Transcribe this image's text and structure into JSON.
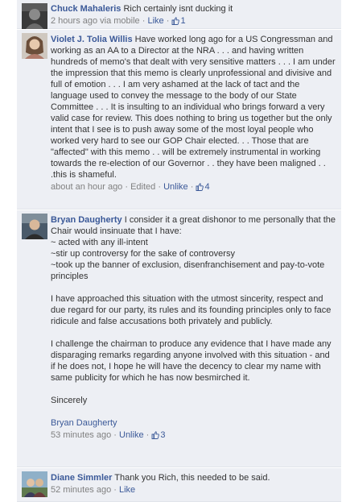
{
  "comments": [
    {
      "author": "Chuck Mahaleris",
      "text": "Rich certainly isnt ducking it",
      "time": "2 hours ago via mobile",
      "sep1": " · ",
      "action": "Like",
      "sep2": " · ",
      "likes": "1"
    },
    {
      "author": "Violet J. Tolia Willis",
      "text": "Have worked long ago for a US Congressman and working as an AA to a Director at the NRA . . . and having written hundreds of memo's that dealt with very sensitive matters . . . I am under the impression that this memo is clearly unprofessional and divisive and full of emotion . . . I am very ashamed at the lack of tact and the language used to convey the message to the body of our State Committee . . . It is insulting to an individual who brings forward a very valid case for review. This does nothing to bring us together but the only intent that I see is to push away some of the most loyal people who worked very hard to see our GOP Chair elected. . . Those that are \"affected\" with this memo . . will be extremely instrumental in working towards the re-election of our Governor . . they have been maligned . . .this is shameful.",
      "time": "about an hour ago",
      "sep1": " · ",
      "edited": "Edited",
      "sep2": " · ",
      "action": "Unlike",
      "sep3": " · ",
      "likes": "4"
    },
    {
      "author": "Bryan Daugherty",
      "p1_intro": "I consider it a great dishonor to me personally that the Chair would insinuate that I have:",
      "p1_line1": "~ acted with any ill-intent",
      "p1_line2": "~stir up controversy for the sake of controversy",
      "p1_line3": "~took up the banner of exclusion, disenfranchisement and pay-to-vote principles",
      "p2": "I have approached this situation with the utmost sincerity, respect and due regard for our party, its rules and its founding principles only to face ridicule and false accusations both privately and publicly.",
      "p3": "I challenge the chairman to produce any evidence that I have made any disparaging remarks regarding anyone involved with this situation - and if he does not, I hope he will have the decency to clear my name with same publicity for which he has now besmirched it.",
      "p4": "Sincerely",
      "signature": "Bryan Daugherty",
      "time": "53 minutes ago",
      "sep1": " · ",
      "action": "Unlike",
      "sep2": " · ",
      "likes": "3"
    },
    {
      "author": "Diane Simmler",
      "text": "Thank you Rich, this needed to be said.",
      "time": "52 minutes ago",
      "sep1": " · ",
      "action": "Like"
    }
  ]
}
